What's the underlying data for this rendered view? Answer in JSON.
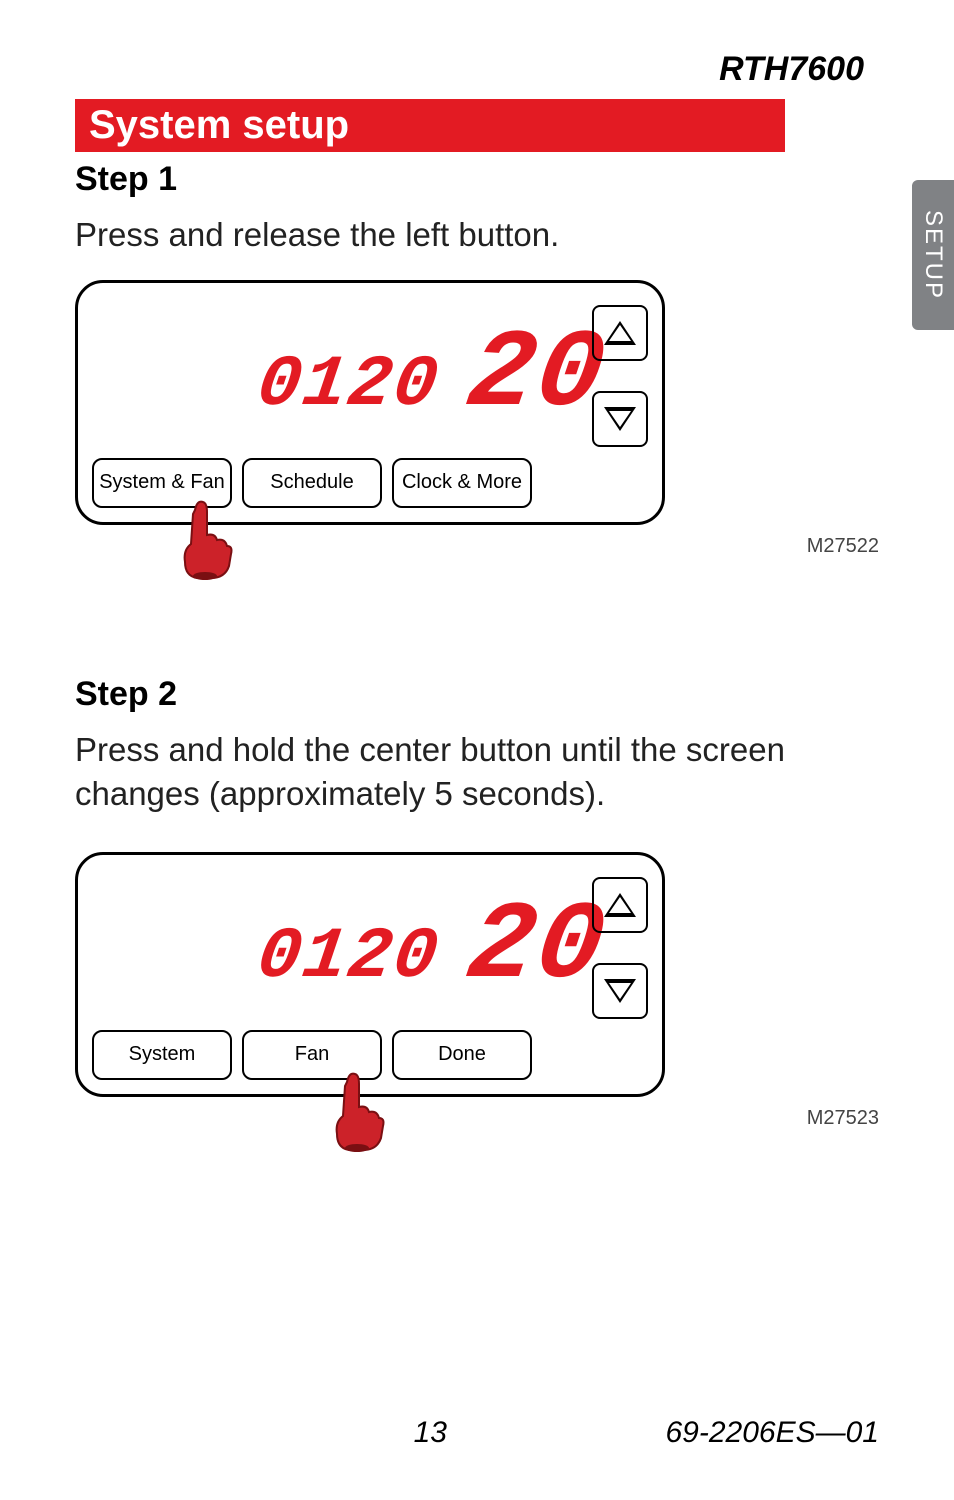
{
  "header": {
    "model": "RTH7600"
  },
  "sideTab": "SETUP",
  "section": {
    "title": "System setup"
  },
  "steps": [
    {
      "label": "Step 1",
      "instruction": "Press and release the left button.",
      "display": {
        "small": "0120",
        "large": "20"
      },
      "buttons": [
        "System & Fan",
        "Schedule",
        "Clock & More"
      ],
      "figureLabel": "M27522",
      "pointerButtonIndex": 0
    },
    {
      "label": "Step 2",
      "instruction": "Press and hold the center button until the screen changes (approximately 5 seconds).",
      "display": {
        "small": "0120",
        "large": "20"
      },
      "buttons": [
        "System",
        "Fan",
        "Done"
      ],
      "figureLabel": "M27523",
      "pointerButtonIndex": 1
    }
  ],
  "footer": {
    "page": "13",
    "docId": "69-2206ES—01"
  }
}
